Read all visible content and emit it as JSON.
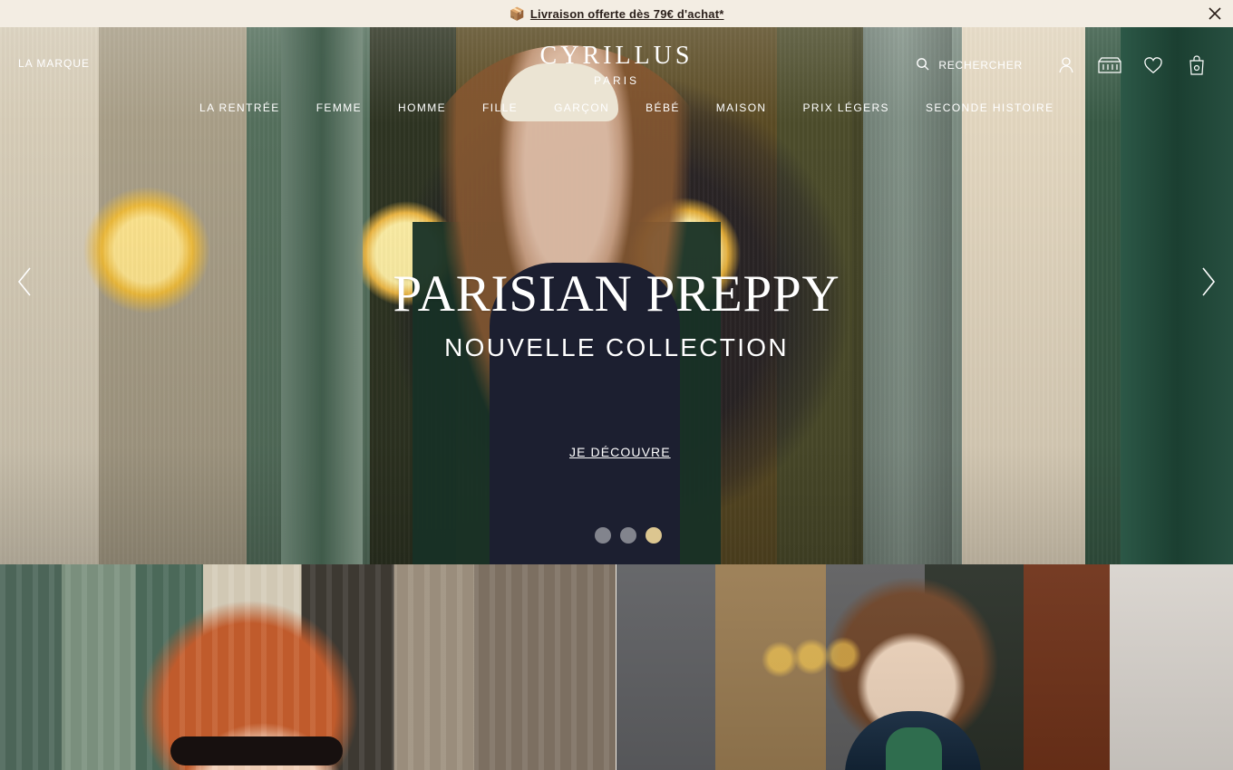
{
  "announcement": {
    "icon": "package-icon",
    "text": "Livraison offerte dès 79€ d'achat*"
  },
  "header": {
    "left_link": "LA MARQUE",
    "brand": {
      "name": "CYRILLUS",
      "subtitle": "PARIS"
    },
    "search_label": "RECHERCHER",
    "nav_items": [
      "LA RENTRÉE",
      "FEMME",
      "HOMME",
      "FILLE",
      "GARÇON",
      "BÉBÉ",
      "MAISON",
      "PRIX LÉGERS",
      "SECONDE HISTOIRE"
    ]
  },
  "hero": {
    "title": "PARISIAN PREPPY",
    "subtitle": "NOUVELLE COLLECTION",
    "cta": "JE DÉCOUVRE",
    "carousel": {
      "total_slides": 3,
      "active_slide": 3
    }
  },
  "colors": {
    "topbar_bg": "#f3ede3",
    "text_dark": "#2a1f1a",
    "accent_gold": "#dcc690",
    "white": "#ffffff"
  }
}
